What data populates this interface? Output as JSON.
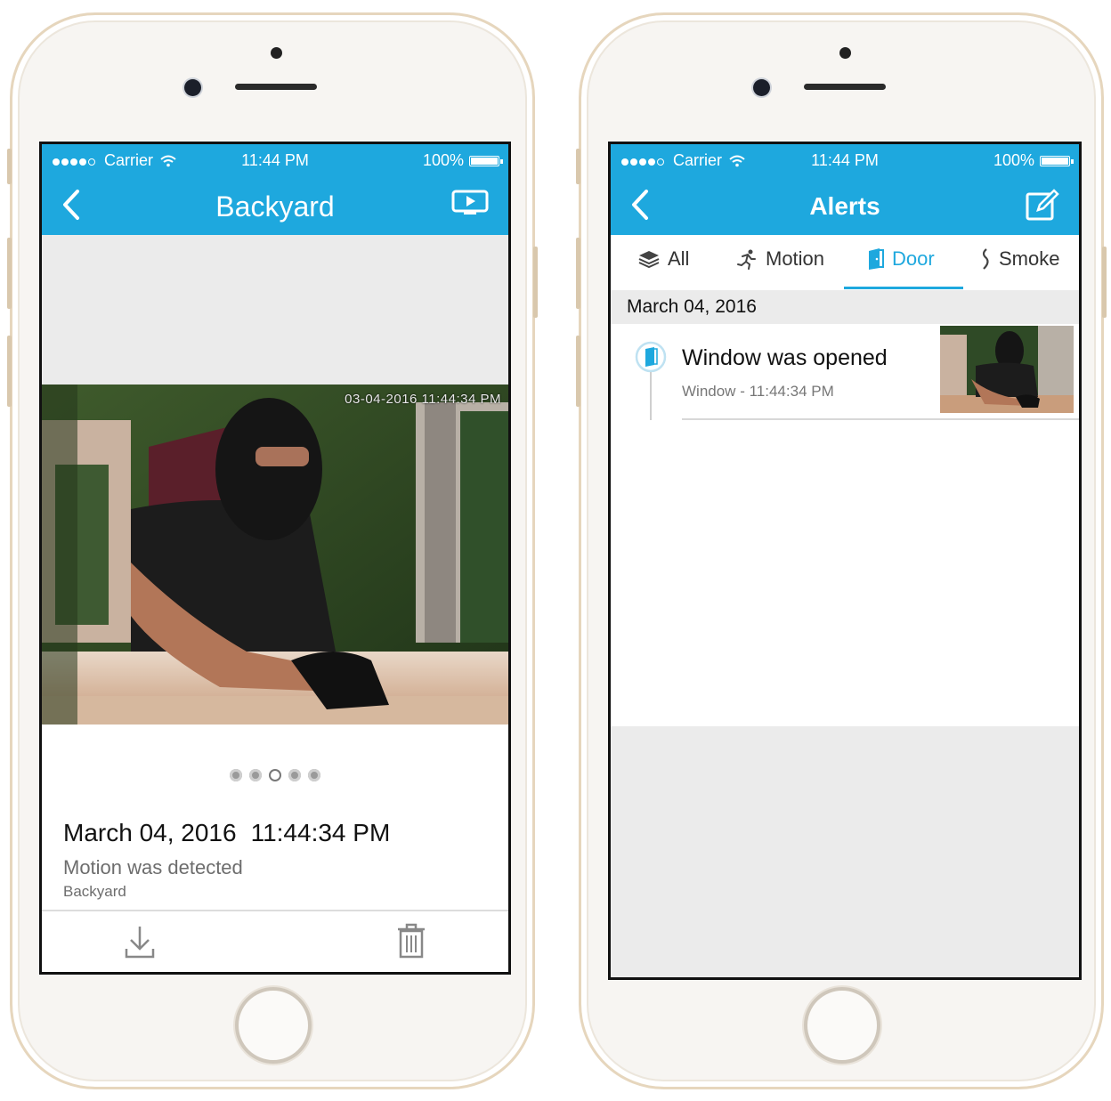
{
  "colors": {
    "accent": "#1ea8de",
    "gray_band": "#ebebeb",
    "text_dark": "#111111",
    "text_muted": "#6d6d6d"
  },
  "left_phone": {
    "status": {
      "carrier": "Carrier",
      "time": "11:44 PM",
      "battery": "100%"
    },
    "nav": {
      "title": "Backyard",
      "back_icon": "chevron-left-icon",
      "action_icon": "play-video-icon"
    },
    "photo_stamp": "03-04-2016 11:44:34 PM",
    "pager": {
      "count": 5,
      "active_index": 2
    },
    "event": {
      "date": "March 04, 2016",
      "time": "11:44:34 PM",
      "message": "Motion was detected",
      "location": "Backyard"
    },
    "toolbar": {
      "download_icon": "download-icon",
      "delete_icon": "trash-icon"
    }
  },
  "right_phone": {
    "status": {
      "carrier": "Carrier",
      "time": "11:44 PM",
      "battery": "100%"
    },
    "nav": {
      "title": "Alerts",
      "back_icon": "chevron-left-icon",
      "action_icon": "edit-icon"
    },
    "filters": [
      {
        "label": "All",
        "icon": "layers-icon",
        "active": false
      },
      {
        "label": "Motion",
        "icon": "running-icon",
        "active": false
      },
      {
        "label": "Door",
        "icon": "door-icon",
        "active": true
      },
      {
        "label": "Smoke",
        "icon": "smoke-icon",
        "active": false
      }
    ],
    "date_header": "March 04, 2016",
    "alerts": [
      {
        "title": "Window was opened",
        "sensor": "Window",
        "separator": "-",
        "time": "11:44:34 PM"
      }
    ]
  }
}
